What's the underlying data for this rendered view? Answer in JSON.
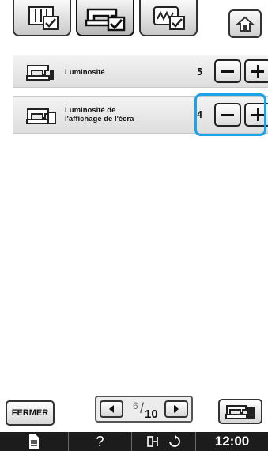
{
  "tabs": [
    {
      "name": "tab-general-settings",
      "active": false
    },
    {
      "name": "tab-machine-settings",
      "active": true
    },
    {
      "name": "tab-embroidery-settings",
      "active": false
    }
  ],
  "home_icon": "home-icon",
  "settings": [
    {
      "label": "Luminosité",
      "value": "5",
      "icon": "sewing-machine-light-icon"
    },
    {
      "label": "Luminosité de\nl'affichage de l'écra",
      "value": "4",
      "icon": "sewing-machine-screen-icon"
    }
  ],
  "stepper": {
    "minus_icon": "minus-icon",
    "plus_icon": "plus-icon"
  },
  "footer": {
    "close_label": "FERMER",
    "page_current": "6",
    "page_total": "10",
    "prev_icon": "arrow-left-icon",
    "next_icon": "arrow-right-icon",
    "mode_icon": "sewing-machine-mode-icon"
  },
  "statusbar": {
    "doc_icon": "document-icon",
    "help_label": "?",
    "icons": [
      "foot-pedal-icon",
      "rotate-icon"
    ],
    "clock": "12:00"
  },
  "colors": {
    "highlight": "#1aa3e8",
    "status_bg": "#1c1c1c"
  }
}
